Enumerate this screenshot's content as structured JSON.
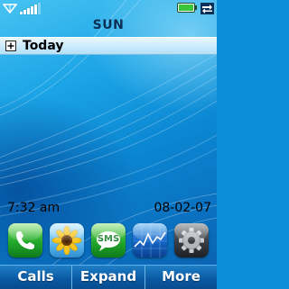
{
  "status": {
    "signal_level": 5,
    "signal_bars_total": 6
  },
  "home": {
    "day": "SUN",
    "today_label": "Today",
    "time": "7:32 am",
    "date": "08-02-07"
  },
  "dock": {
    "apps": [
      {
        "name": "phone-app",
        "icon": "phone-icon"
      },
      {
        "name": "photos-app",
        "icon": "sunflower-icon"
      },
      {
        "name": "sms-app",
        "icon": "sms-icon",
        "label": "SMS"
      },
      {
        "name": "stocks-app",
        "icon": "chart-icon"
      },
      {
        "name": "settings-app",
        "icon": "gear-icon"
      }
    ]
  },
  "softkeys": {
    "left": "Calls",
    "center": "Expand",
    "right": "More"
  },
  "colors": {
    "wallpaper": "#0a8fd6",
    "softkey_bar": "#0b5aa4",
    "today_bar": "#c7e9fb"
  }
}
